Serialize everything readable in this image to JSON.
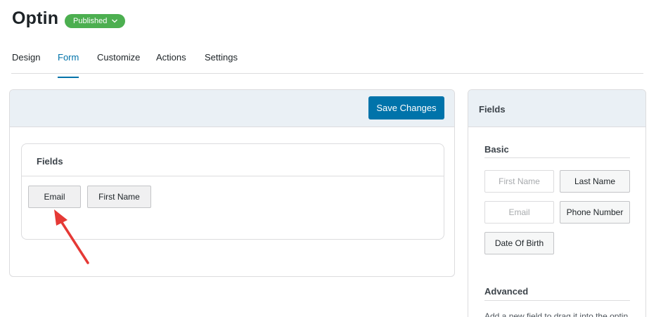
{
  "header": {
    "title": "Optin",
    "status": "Published"
  },
  "tabs": [
    {
      "label": "Design"
    },
    {
      "label": "Form"
    },
    {
      "label": "Customize"
    },
    {
      "label": "Actions"
    },
    {
      "label": "Settings"
    }
  ],
  "builder": {
    "save_label": "Save Changes",
    "fields_title": "Fields",
    "fields": [
      {
        "label": "Email"
      },
      {
        "label": "First Name"
      }
    ]
  },
  "sidebar": {
    "title": "Fields",
    "basic_title": "Basic",
    "basic_fields": [
      {
        "label": "First Name",
        "state": "disabled"
      },
      {
        "label": "Last Name",
        "state": "enabled"
      },
      {
        "label": "Email",
        "state": "disabled"
      },
      {
        "label": "Phone Number",
        "state": "enabled"
      },
      {
        "label": "Date Of Birth",
        "state": "enabled"
      }
    ],
    "advanced_title": "Advanced",
    "advanced_note": "Add a new field to drag it into the optin"
  },
  "icons": {
    "status_dropdown": "chevron-down-icon",
    "annotation": "red-arrow-icon"
  },
  "colors": {
    "accent": "#0073aa",
    "status_badge": "#4caf50",
    "header_bg": "#eaf0f5",
    "annotation_arrow": "#e53935"
  }
}
